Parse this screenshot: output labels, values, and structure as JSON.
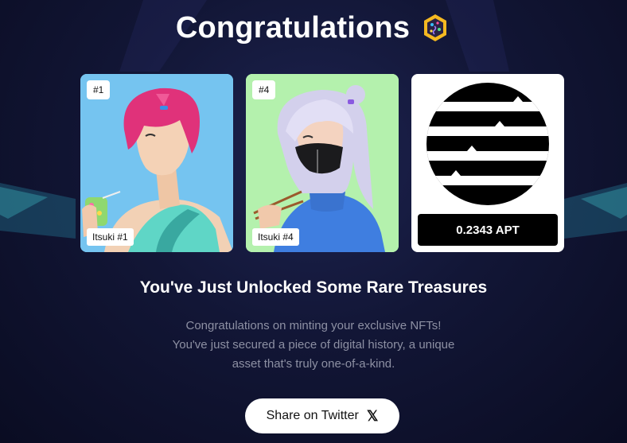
{
  "header": {
    "title": "Congratulations",
    "badge_icon": "party-badge-icon"
  },
  "nfts": [
    {
      "rank": "#1",
      "name": "Itsuki #1",
      "background": "#75c4f0"
    },
    {
      "rank": "#4",
      "name": "Itsuki #4",
      "background": "#b4f1ad"
    }
  ],
  "token": {
    "icon": "aptos-logo-icon",
    "amount": "0.2343 APT"
  },
  "main": {
    "heading": "You've Just Unlocked Some Rare Treasures",
    "description_lines": [
      "Congratulations on minting your exclusive NFTs!",
      "You've just secured a piece of digital history, a unique",
      "asset that's truly one-of-a-kind."
    ]
  },
  "share": {
    "label": "Share on Twitter",
    "icon": "x-logo-icon",
    "icon_glyph": "𝕏"
  }
}
